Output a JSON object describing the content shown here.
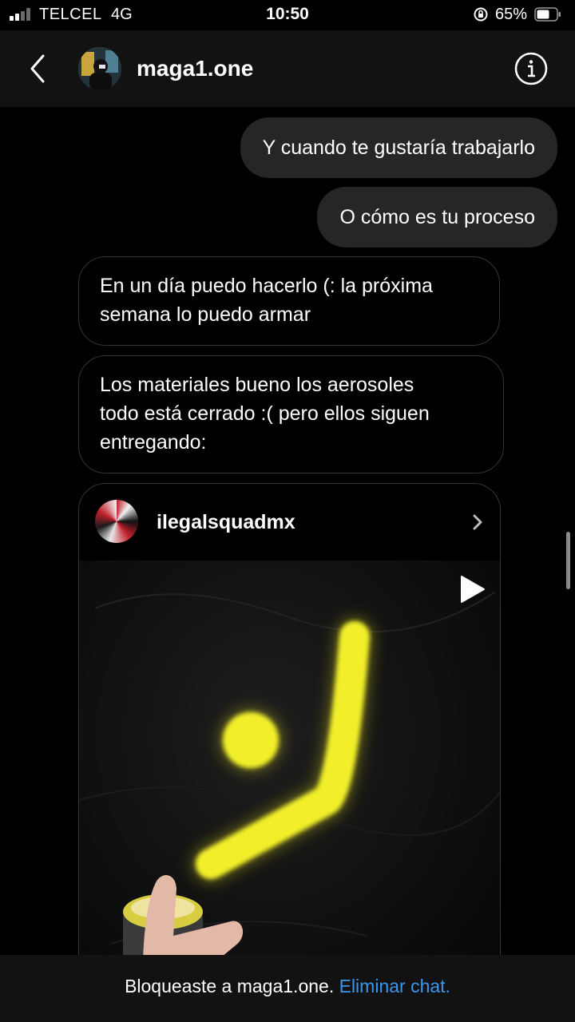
{
  "status_bar": {
    "carrier": "TELCEL",
    "network": "4G",
    "time": "10:50",
    "battery_percent": "65%",
    "battery_level": 0.65,
    "signal_bars": 2,
    "icons": [
      "signal-icon",
      "rotation-lock-icon",
      "battery-icon"
    ]
  },
  "header": {
    "username": "maga1.one",
    "back_icon": "chevron-left-icon",
    "info_icon": "info-icon"
  },
  "messages": [
    {
      "direction": "outgoing",
      "text": "Y cuando te gustaría trabajarlo"
    },
    {
      "direction": "outgoing",
      "text": "O cómo es tu proceso"
    },
    {
      "direction": "incoming",
      "lines": [
        "En un día puedo hacerlo (: la próxima",
        "semana lo puedo armar"
      ]
    },
    {
      "direction": "incoming",
      "lines": [
        "Los materiales bueno los aerosoles",
        "todo está cerrado :( pero ellos siguen",
        "entregando:"
      ]
    }
  ],
  "shared_post": {
    "username": "ilegalsquadmx",
    "media_type": "video",
    "chevron_icon": "chevron-right-icon",
    "play_icon": "play-icon"
  },
  "footer": {
    "text": "Bloqueaste a maga1.one.",
    "link": "Eliminar chat."
  },
  "colors": {
    "background": "#000000",
    "header_bg": "#121212",
    "outgoing_bubble": "#262626",
    "incoming_border": "#363636",
    "link": "#3897f0",
    "spray_paint": "#f2ef2a"
  }
}
